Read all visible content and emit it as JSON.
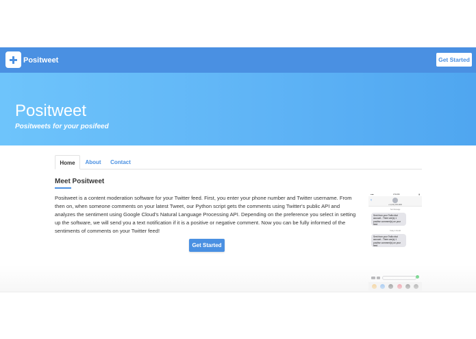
{
  "navbar": {
    "brand": "Positweet",
    "cta_label": "Get Started",
    "logo_icon": "plus-icon",
    "background_color": "#4a90e2"
  },
  "hero": {
    "title": "Positweet",
    "subtitle": "Positweets for your posifeed"
  },
  "tabs": [
    {
      "label": "Home",
      "active": true
    },
    {
      "label": "About",
      "active": false
    },
    {
      "label": "Contact",
      "active": false
    }
  ],
  "main": {
    "heading": "Meet Positweet",
    "description": "Positweet is a content moderation software for your Twitter feed. First, you enter your phone number and Twitter username. From then on, when someone comments on your latest Tweet, our Python script gets the comments using Twitter's public API and analyzes the sentiment using Google Cloud's Natural Language Processing API. Depending on the preference you select in setting up the software, we will send you a text notification if it is a positive or negative comment. Now you can be fully informed of the sentiments of comments on your Twitter feed!",
    "cta_label": "Get Started"
  },
  "phone": {
    "time": "1:54 AM",
    "back_icon": "chevron-left-icon",
    "contact": "+1 (213) 245-4000",
    "messages": [
      {
        "timestamp": "Text Message",
        "text": "Sent from your Twilio trial account - There are(s) 1 positive comment(s) on your feed"
      },
      {
        "timestamp": "Today 1:52 AM",
        "text": "Sent from your Twilio trial account - There are(s) 1 positive comment(s) on your feed"
      }
    ],
    "app_icons": [
      "photos-icon",
      "appstore-icon",
      "music-icon",
      "heart-icon",
      "search-icon",
      "apps-icon"
    ]
  }
}
